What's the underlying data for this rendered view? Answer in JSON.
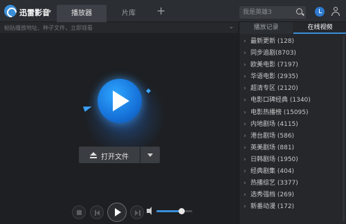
{
  "app": {
    "title": "迅雷影音",
    "caret": "▾"
  },
  "tabs": [
    {
      "label": "播放器"
    },
    {
      "label": "片库"
    }
  ],
  "tab_add": "+",
  "search": {
    "placeholder": "我是英雄3"
  },
  "url_input": {
    "placeholder": "粘贴播放地址、种子文件，立即观看",
    "chevron": "⌄"
  },
  "open_button": {
    "label": "打开文件"
  },
  "volume": {
    "level": 0.7
  },
  "panel": {
    "tabs": [
      {
        "label": "播放记录"
      },
      {
        "label": "在线视频"
      }
    ],
    "arrow": "›",
    "categories": [
      {
        "label": "最新更新 (128)"
      },
      {
        "label": "同步追剧(8703)"
      },
      {
        "label": "欧美电影 (7197)"
      },
      {
        "label": "华语电影 (2935)"
      },
      {
        "label": "超清专区 (2120)"
      },
      {
        "label": "电影口碑经典 (1340)"
      },
      {
        "label": "电影热播榜 (15095)"
      },
      {
        "label": "内地剧场 (4115)"
      },
      {
        "label": "港台剧场 (586)"
      },
      {
        "label": "英美剧场 (881)"
      },
      {
        "label": "日韩剧场 (1950)"
      },
      {
        "label": "经典剧集 (404)"
      },
      {
        "label": "热播综艺 (3377)"
      },
      {
        "label": "选秀强档 (269)"
      },
      {
        "label": "新番动漫 (172)"
      }
    ]
  },
  "icons": {
    "logo": "xunlei-logo-icon",
    "search": "search-icon",
    "history": "clock-icon",
    "user": "user-icon",
    "eject": "eject-icon",
    "volume": "volume-icon"
  },
  "colors": {
    "accent": "#3b8fd9",
    "background": "#1f2124",
    "panel": "#25272b"
  }
}
